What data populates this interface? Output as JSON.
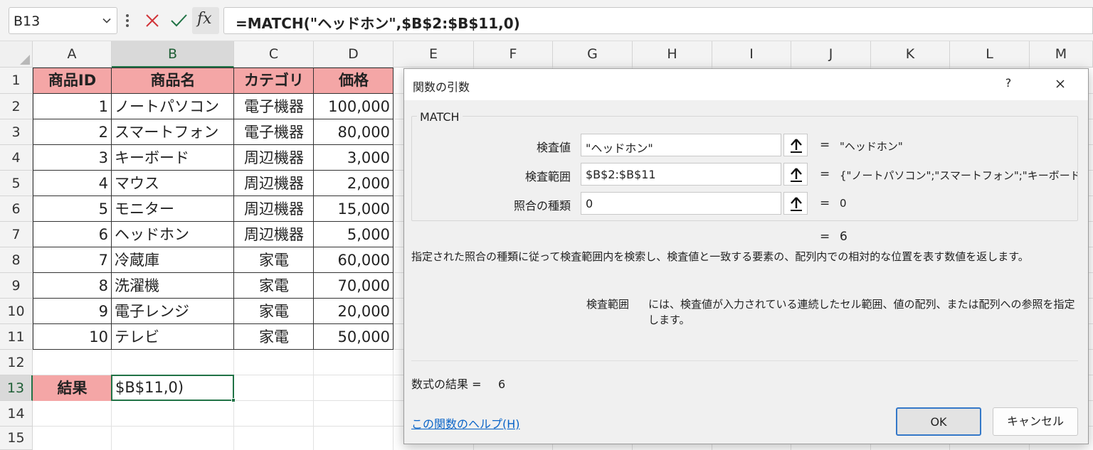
{
  "formula_bar": {
    "name_box": "B13",
    "fx_label": "fx",
    "formula": "=MATCH(\"ヘッドホン\",$B$2:$B$11,0)"
  },
  "columns": [
    "A",
    "B",
    "C",
    "D",
    "E",
    "F",
    "G",
    "H",
    "I",
    "J",
    "K",
    "L",
    "M"
  ],
  "rows": [
    "1",
    "2",
    "3",
    "4",
    "5",
    "6",
    "7",
    "8",
    "9",
    "10",
    "11",
    "12",
    "13",
    "14",
    "15"
  ],
  "table": {
    "headers": [
      "商品ID",
      "商品名",
      "カテゴリ",
      "価格"
    ],
    "rows": [
      [
        "1",
        "ノートパソコン",
        "電子機器",
        "100,000"
      ],
      [
        "2",
        "スマートフォン",
        "電子機器",
        "80,000"
      ],
      [
        "3",
        "キーボード",
        "周辺機器",
        "3,000"
      ],
      [
        "4",
        "マウス",
        "周辺機器",
        "2,000"
      ],
      [
        "5",
        "モニター",
        "周辺機器",
        "15,000"
      ],
      [
        "6",
        "ヘッドホン",
        "周辺機器",
        "5,000"
      ],
      [
        "7",
        "冷蔵庫",
        "家電",
        "60,000"
      ],
      [
        "8",
        "洗濯機",
        "家電",
        "70,000"
      ],
      [
        "9",
        "電子レンジ",
        "家電",
        "20,000"
      ],
      [
        "10",
        "テレビ",
        "家電",
        "50,000"
      ]
    ]
  },
  "result_row": {
    "label": "結果",
    "value": "$B$11,0)"
  },
  "dialog": {
    "title": "関数の引数",
    "help_symbol": "?",
    "function_name": "MATCH",
    "args": [
      {
        "label": "検査値",
        "value": "\"ヘッドホン\"",
        "result": "\"ヘッドホン\""
      },
      {
        "label": "検査範囲",
        "value": "$B$2:$B$11",
        "result": "{\"ノートパソコン\";\"スマートフォン\";\"キーボード"
      },
      {
        "label": "照合の種類",
        "value": "0",
        "result": "0"
      }
    ],
    "equals": "=",
    "overall_result": "6",
    "description": "指定された照合の種類に従って検査範囲内を検索し、検査値と一致する要素の、配列内での相対的な位置を表す数値を返します。",
    "arg_help_name": "検査範囲",
    "arg_help_text": "には、検査値が入力されている連続したセル範囲、値の配列、または配列への参照を指定します。",
    "formula_result_label": "数式の結果 =",
    "formula_result_value": "6",
    "help_link": "この関数のヘルプ(H)",
    "ok_label": "OK",
    "cancel_label": "キャンセル"
  }
}
